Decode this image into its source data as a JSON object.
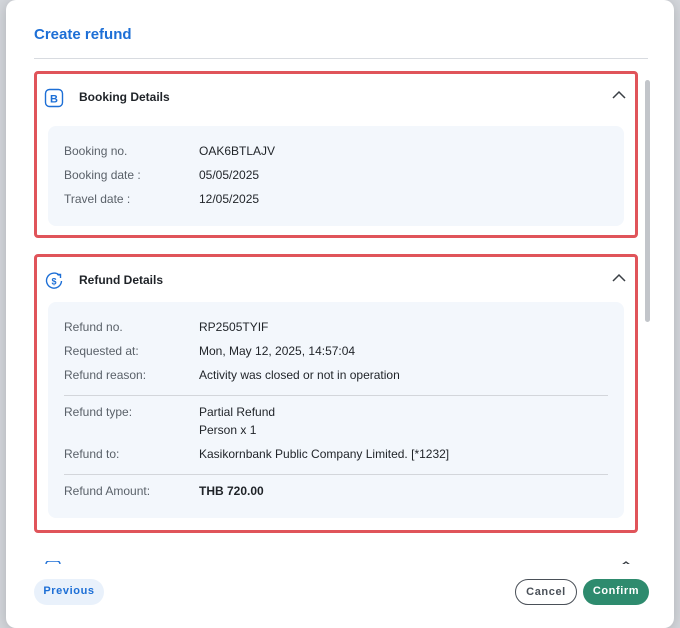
{
  "dialog": {
    "title": "Create refund"
  },
  "booking": {
    "title": "Booking Details",
    "rows": [
      {
        "label": "Booking no.",
        "value": "OAK6BTLAJV"
      },
      {
        "label": "Booking date :",
        "value": "05/05/2025"
      },
      {
        "label": "Travel date :",
        "value": "12/05/2025"
      }
    ]
  },
  "refund": {
    "title": "Refund Details",
    "rows": [
      {
        "label": "Refund no.",
        "value": "RP2505TYIF"
      },
      {
        "label": "Requested at:",
        "value": "Mon, May 12, 2025, 14:57:04"
      },
      {
        "label": "Refund reason:",
        "value": "Activity was closed or not in operation"
      }
    ],
    "type_label": "Refund type:",
    "type_value": "Partial Refund",
    "type_detail": "Person x 1",
    "to_label": "Refund to:",
    "to_value": "Kasikornbank Public Company Limited. [*1232]",
    "amount_label": "Refund Amount:",
    "amount_value": "THB 720.00"
  },
  "footer": {
    "previous_label": "Previous",
    "cancel_label": "Cancel",
    "confirm_label": "Confirm"
  },
  "colors": {
    "accent": "#1d6fd6",
    "highlight_border": "#e0545a",
    "confirm": "#2e8b6e",
    "details_bg": "#f3f7fc"
  },
  "icons": [
    "booking-b-icon",
    "refund-dollar-icon",
    "chevron-up-icon"
  ]
}
